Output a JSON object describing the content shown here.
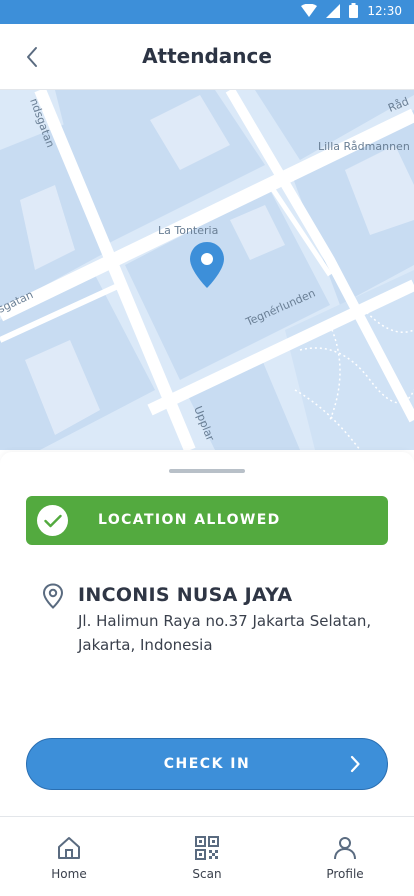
{
  "status_bar": {
    "time": "12:30",
    "icons": [
      "wifi-icon",
      "signal-icon",
      "battery-icon"
    ],
    "background": "#3d8fd9"
  },
  "header": {
    "title": "Attendance",
    "back_icon": "back-arrow-icon"
  },
  "map": {
    "street_labels": [
      "ndsgatan",
      "Råd",
      "Lilla Rådmannen",
      "La Tonteria",
      "sgatan",
      "Tegnérlunden",
      "Upplar"
    ],
    "marker_icon": "location-pin-icon",
    "colors": {
      "block": "#c8dcf2",
      "land": "#dbe9f8",
      "road": "#ffffff",
      "marker": "#3d8fd9"
    }
  },
  "location_status": {
    "label": "LOCATION ALLOWED",
    "icon": "checkmark-icon",
    "color": "#53aa3f"
  },
  "office": {
    "icon": "location-outline-icon",
    "name": "INCONIS NUSA JAYA",
    "address_line1": "Jl. Halimun Raya no.37 Jakarta Selatan,",
    "address_line2": "Jakarta, Indonesia"
  },
  "check_in": {
    "label": "CHECK IN",
    "icon": "chevron-right-icon",
    "color": "#3d8fd9"
  },
  "bottom_nav": {
    "items": [
      {
        "label": "Home",
        "icon": "home-icon"
      },
      {
        "label": "Scan",
        "icon": "qr-code-icon"
      },
      {
        "label": "Profile",
        "icon": "user-icon"
      }
    ]
  }
}
